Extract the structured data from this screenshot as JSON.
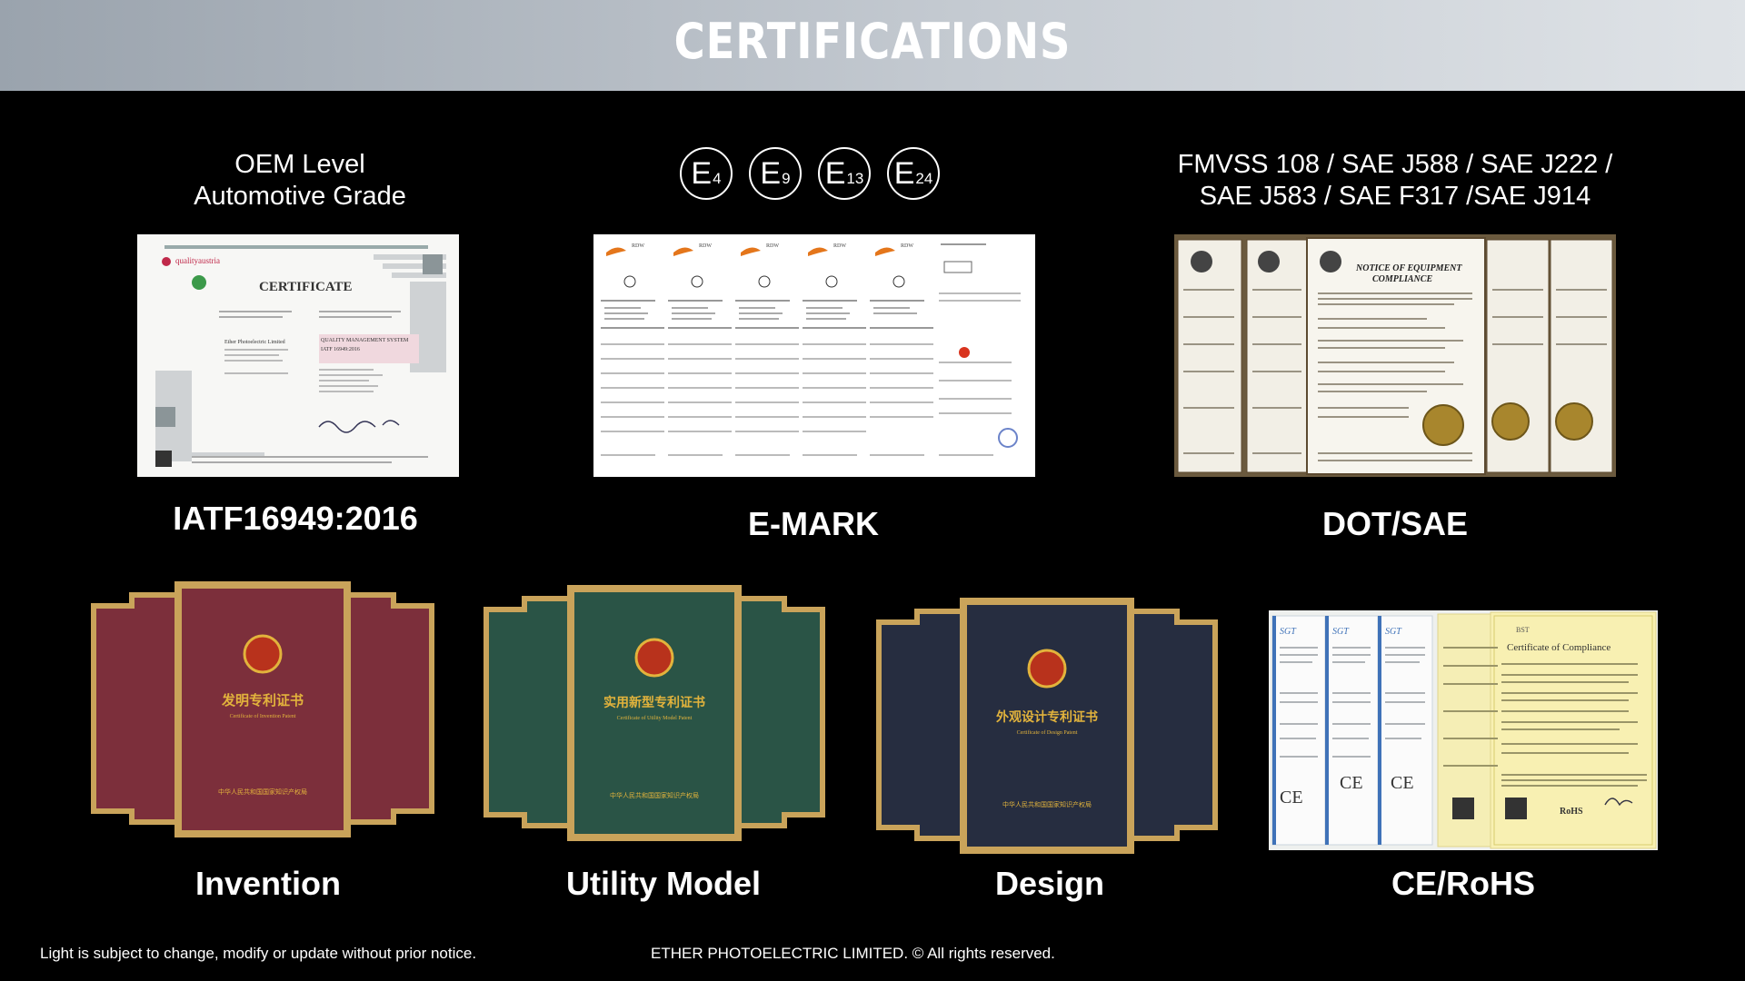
{
  "header": {
    "title": "CERTIFICATIONS"
  },
  "top": {
    "iatf": {
      "heading_line1": "OEM Level",
      "heading_line2": "Automotive Grade",
      "caption": "IATF16949:2016",
      "doc": {
        "brand": "qualityaustria",
        "title": "CERTIFICATE",
        "system": "QUALITY MANAGEMENT SYSTEM",
        "standard": "IATF 16949:2016",
        "company": "Ether Photoelectric Limited"
      }
    },
    "emark": {
      "marks": [
        {
          "e": "E",
          "n": "4"
        },
        {
          "e": "E",
          "n": "9"
        },
        {
          "e": "E",
          "n": "13"
        },
        {
          "e": "E",
          "n": "24"
        }
      ],
      "caption": "E-MARK",
      "doc_header": "RDW"
    },
    "dot": {
      "heading_line1": "FMVSS 108 / SAE J588 / SAE J222 /",
      "heading_line2": "SAE J583 / SAE F317 /SAE J914",
      "caption": "DOT/SAE",
      "doc": {
        "title": "NOTICE OF EQUIPMENT",
        "subtitle": "COMPLIANCE"
      }
    }
  },
  "bottom": {
    "invention": {
      "caption": "Invention",
      "cn_title": "发明专利证书",
      "en_title": "Certificate of Invention Patent",
      "issuer": "中华人民共和国国家知识产权局",
      "color": "#7c2f3b"
    },
    "utility": {
      "caption": "Utility Model",
      "cn_title": "实用新型专利证书",
      "en_title": "Certificate of Utility Model Patent",
      "issuer": "中华人民共和国国家知识产权局",
      "color": "#2a5446"
    },
    "design": {
      "caption": "Design",
      "cn_title": "外观设计专利证书",
      "en_title": "Certificate of Design Patent",
      "issuer": "中华人民共和国国家知识产权局",
      "color": "#262d40"
    },
    "ce": {
      "caption": "CE/RoHS",
      "doc_title": "Certificate of Compliance",
      "brand1": "SGT",
      "brand2": "BST",
      "mark": "CE",
      "rohs": "RoHS"
    }
  },
  "footer": {
    "left": "Light is subject to change, modify or update without prior notice.",
    "center": "ETHER PHOTOELECTRIC LIMITED. © All rights reserved."
  }
}
